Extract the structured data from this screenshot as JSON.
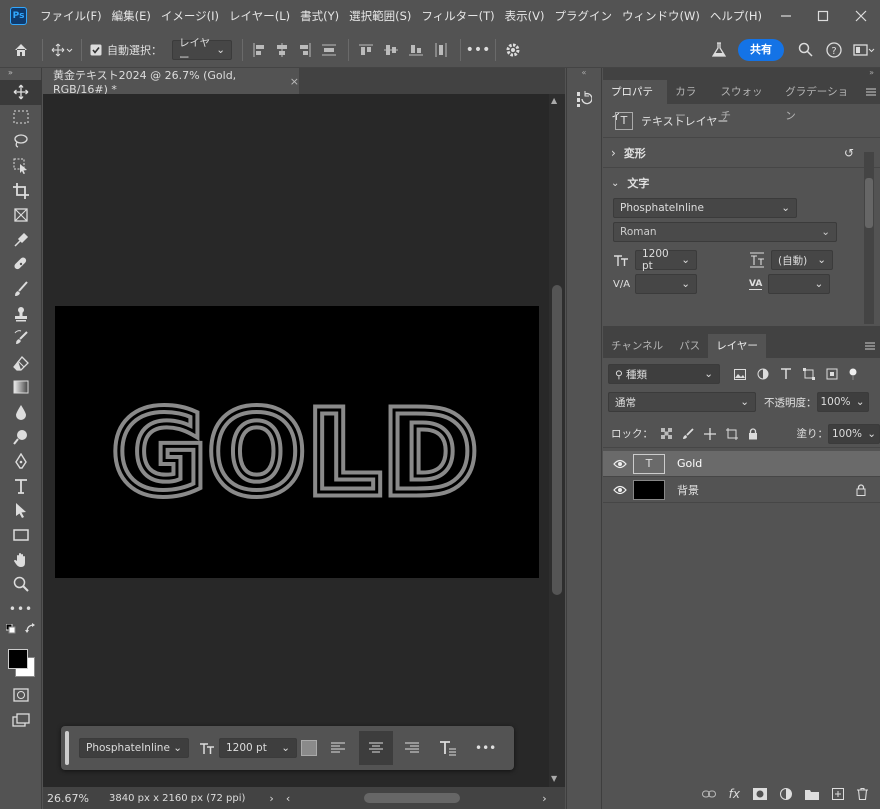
{
  "menu": {
    "items": [
      "ファイル(F)",
      "編集(E)",
      "イメージ(I)",
      "レイヤー(L)",
      "書式(Y)",
      "選択範囲(S)",
      "フィルター(T)",
      "表示(V)",
      "プラグイン",
      "ウィンドウ(W)",
      "ヘルプ(H)"
    ],
    "logo": "Ps"
  },
  "options": {
    "auto_select_label": "自動選択：",
    "auto_select_value": "レイヤー",
    "share_label": "共有"
  },
  "document": {
    "tab_title": "黄金テキスト2024 @ 26.7% (Gold, RGB/16#) *",
    "canvas_text": "GOLD",
    "zoom": "26.67%",
    "dimensions": "3840 px x 2160 px (72 ppi)"
  },
  "context_bar": {
    "font": "PhosphateInline",
    "size": "1200 pt"
  },
  "properties": {
    "tabs": [
      "プロパティ",
      "カラー",
      "スウォッチ",
      "グラデーション"
    ],
    "layer_type": "テキストレイヤー",
    "transform_label": "変形",
    "character_label": "文字",
    "font_family": "PhosphateInline",
    "font_style": "Roman",
    "font_size": "1200 pt",
    "leading": "(自動)",
    "kerning_label": "V/A",
    "tracking_label": "VA"
  },
  "layers_panel": {
    "tabs": [
      "チャンネル",
      "パス",
      "レイヤー"
    ],
    "filter_kind": "種類",
    "blend_mode": "通常",
    "opacity_label": "不透明度：",
    "opacity": "100%",
    "lock_label": "ロック：",
    "fill_label": "塗り：",
    "fill": "100%",
    "layers": [
      {
        "name": "Gold",
        "type": "text"
      },
      {
        "name": "背景",
        "type": "background"
      }
    ]
  },
  "colors": {
    "accent": "#1473e6",
    "panel": "#535353",
    "canvas_bg": "#282828"
  }
}
